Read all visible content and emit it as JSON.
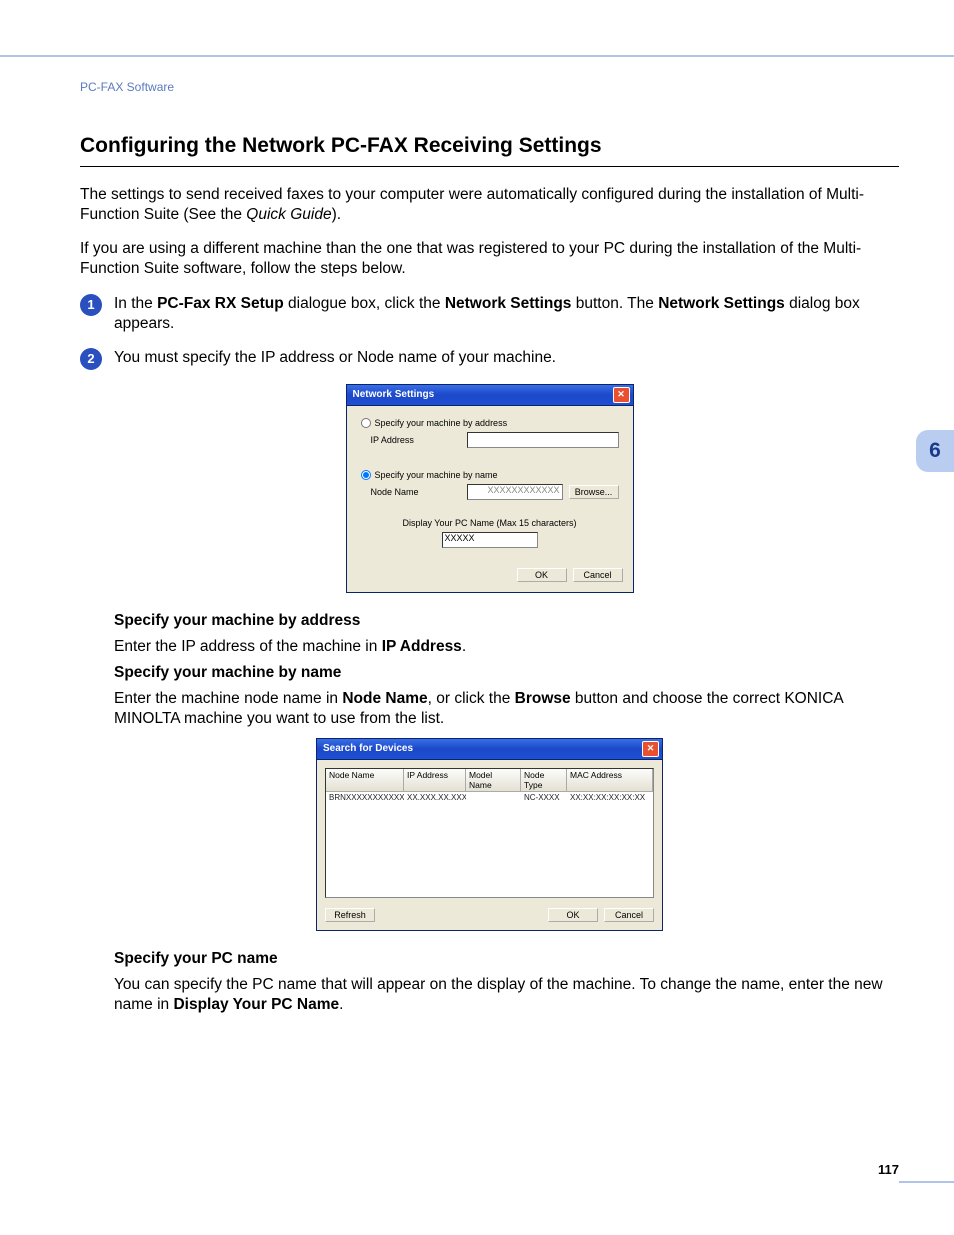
{
  "breadcrumb": "PC-FAX Software",
  "title": "Configuring the Network PC-FAX Receiving Settings",
  "intro1a": "The settings to send received faxes to your computer were automatically configured during the installation of Multi-Function Suite (See the ",
  "intro1b": "Quick Guide",
  "intro1c": ").",
  "intro2": "If you are using a different machine than the one that was registered to your PC during the installation of the Multi-Function Suite software, follow the steps below.",
  "step1": {
    "a": "In the ",
    "b": "PC-Fax RX Setup",
    "c": " dialogue box, click the ",
    "d": "Network Settings",
    "e": " button. The ",
    "f": "Network Settings",
    "g": " dialog box appears."
  },
  "step2": "You must specify the IP address or Node name of your machine.",
  "dialog1": {
    "title": "Network Settings",
    "opt_addr": "Specify your machine by address",
    "lbl_ip": "IP Address",
    "opt_name": "Specify your machine by name",
    "lbl_node": "Node Name",
    "node_value": "XXXXXXXXXXXX",
    "browse": "Browse...",
    "lbl_pc": "Display Your PC Name (Max 15 characters)",
    "pc_value": "XXXXX",
    "ok": "OK",
    "cancel": "Cancel"
  },
  "sec1_head": "Specify your machine by address",
  "sec1": {
    "a": "Enter the IP address of the machine in ",
    "b": "IP Address",
    "c": "."
  },
  "sec2_head": "Specify your machine by name",
  "sec2": {
    "a": "Enter the machine node name in ",
    "b": "Node Name",
    "c": ", or click the ",
    "d": "Browse",
    "e": " button and choose the correct KONICA MINOLTA machine you want to use from the list."
  },
  "dialog2": {
    "title": "Search for Devices",
    "cols": [
      "Node Name",
      "IP Address",
      "Model Name",
      "Node Type",
      "MAC Address"
    ],
    "row": [
      "BRNXXXXXXXXXXXX",
      "XX.XXX.XX.XXX",
      "",
      "NC-XXXX",
      "XX:XX:XX:XX:XX:XX"
    ],
    "refresh": "Refresh",
    "ok": "OK",
    "cancel": "Cancel"
  },
  "sec3_head": "Specify your PC name",
  "sec3": {
    "a": "You can specify the PC name that will appear on the display of the machine. To change the name, enter the new name in ",
    "b": "Display Your PC Name",
    "c": "."
  },
  "chapter": "6",
  "page_number": "117"
}
